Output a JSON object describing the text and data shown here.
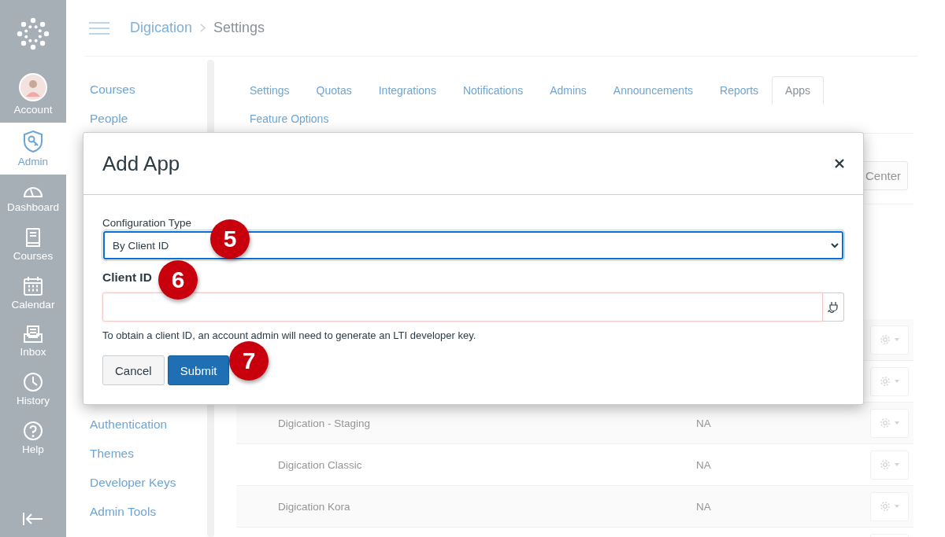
{
  "global_nav": {
    "items": [
      {
        "label": "Account",
        "kind": "avatar",
        "selected": false
      },
      {
        "label": "Admin",
        "kind": "admin",
        "selected": true
      },
      {
        "label": "Dashboard",
        "kind": "dashboard",
        "selected": false
      },
      {
        "label": "Courses",
        "kind": "courses",
        "selected": false
      },
      {
        "label": "Calendar",
        "kind": "calendar",
        "selected": false
      },
      {
        "label": "Inbox",
        "kind": "inbox",
        "selected": false
      },
      {
        "label": "History",
        "kind": "history",
        "selected": false
      },
      {
        "label": "Help",
        "kind": "help",
        "selected": false
      }
    ]
  },
  "breadcrumb": [
    "Digication",
    "Settings"
  ],
  "sub_nav": {
    "items_top": [
      "Courses",
      "People"
    ],
    "items_bottom": [
      "Authentication",
      "Themes",
      "Developer Keys",
      "Admin Tools"
    ]
  },
  "tabs": [
    {
      "label": "Settings",
      "selected": false
    },
    {
      "label": "Quotas",
      "selected": false
    },
    {
      "label": "Integrations",
      "selected": false
    },
    {
      "label": "Notifications",
      "selected": false
    },
    {
      "label": "Admins",
      "selected": false
    },
    {
      "label": "Announcements",
      "selected": false
    },
    {
      "label": "Reports",
      "selected": false
    },
    {
      "label": "Apps",
      "selected": true
    },
    {
      "label": "Feature Options",
      "selected": false
    }
  ],
  "toolbar_button": "Center",
  "apps_table": {
    "rows": [
      {
        "name": "Digication - Staging",
        "column_2": "NA"
      },
      {
        "name": "Digication Classic",
        "column_2": "NA"
      },
      {
        "name": "Digication Kora",
        "column_2": "NA"
      }
    ]
  },
  "dialog": {
    "title": "Add App",
    "config_label": "Configuration Type",
    "config_value": "By Client ID",
    "client_id_label": "Client ID",
    "help": "To obtain a client ID, an account admin will need to generate an LTI developer key.",
    "buttons": [
      {
        "label": "Cancel",
        "kind": "secondary"
      },
      {
        "label": "Submit",
        "kind": "primary"
      }
    ]
  },
  "callouts": [
    "5",
    "6",
    "7"
  ]
}
